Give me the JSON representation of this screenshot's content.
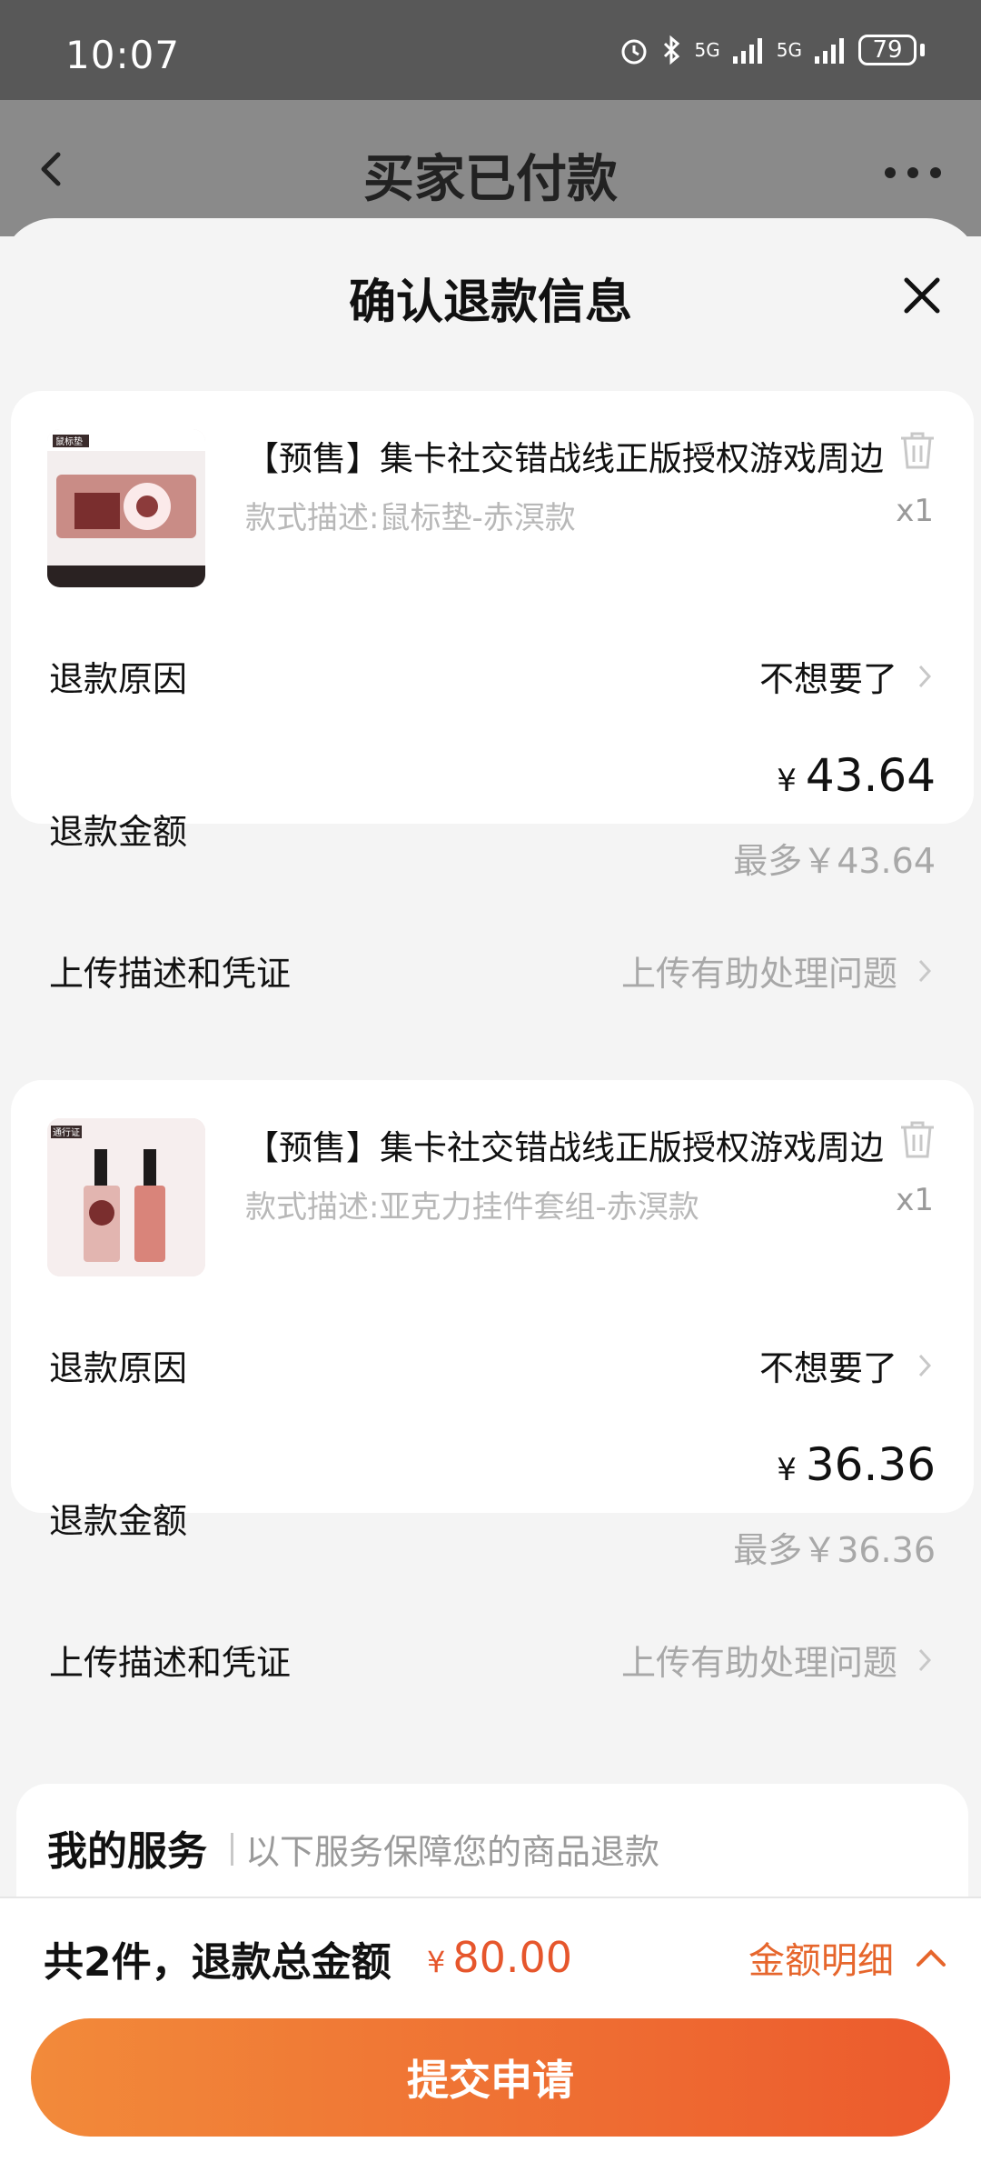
{
  "status_bar": {
    "time": "10:07",
    "network_1": "5G",
    "network_2": "5G",
    "battery": "79"
  },
  "nav": {
    "title": "买家已付款"
  },
  "sheet": {
    "title": "确认退款信息"
  },
  "items": [
    {
      "title": "【预售】集卡社交错战线正版授权游戏周边",
      "desc": "款式描述:鼠标垫-赤溟款",
      "qty": "x1",
      "thumb_label": "鼠标垫",
      "reason_label": "退款原因",
      "reason_value": "不想要了",
      "amount_label": "退款金额",
      "currency": "¥",
      "amount": "43.64",
      "max_text": "最多￥43.64",
      "upload_label": "上传描述和凭证",
      "upload_hint": "上传有助处理问题"
    },
    {
      "title": "【预售】集卡社交错战线正版授权游戏周边",
      "desc": "款式描述:亚克力挂件套组-赤溟款",
      "qty": "x1",
      "thumb_label": "通行证",
      "reason_label": "退款原因",
      "reason_value": "不想要了",
      "amount_label": "退款金额",
      "currency": "¥",
      "amount": "36.36",
      "max_text": "最多￥36.36",
      "upload_label": "上传描述和凭证",
      "upload_hint": "上传有助处理问题"
    }
  ],
  "service": {
    "title": "我的服务",
    "subtitle": "以下服务保障您的商品退款"
  },
  "footer": {
    "total_label": "共2件，退款总金额",
    "currency": "¥",
    "total_amount": "80.00",
    "detail_link": "金额明细",
    "submit_label": "提交申请"
  }
}
